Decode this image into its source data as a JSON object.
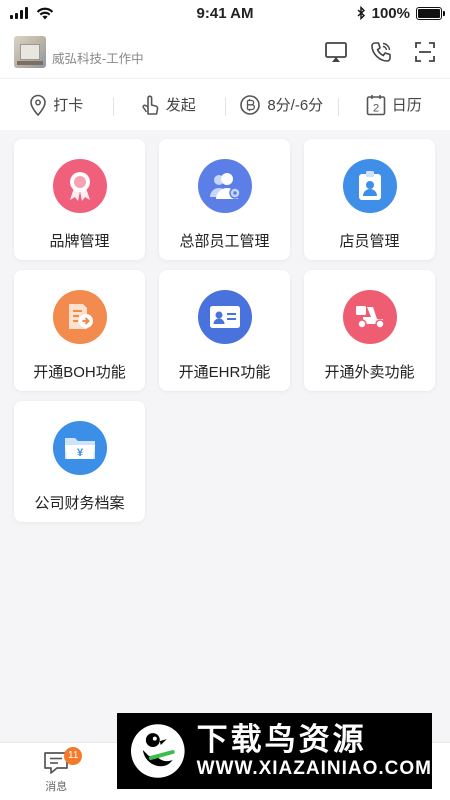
{
  "status_bar": {
    "time": "9:41 AM",
    "battery": "100%"
  },
  "header": {
    "company": "威弘科技-工作中"
  },
  "quick_actions": [
    {
      "label": "打卡",
      "icon": "location-pin-icon"
    },
    {
      "label": "发起",
      "icon": "hand-icon"
    },
    {
      "label": "8分/-6分",
      "icon": "coin-icon"
    },
    {
      "label": "日历",
      "icon": "calendar-icon",
      "day": "2"
    }
  ],
  "modules": [
    {
      "label": "品牌管理",
      "icon": "ribbon-award-icon",
      "color": "#f0607d"
    },
    {
      "label": "总部员工管理",
      "icon": "staff-gear-icon",
      "color": "#5b7fe6"
    },
    {
      "label": "店员管理",
      "icon": "badge-id-icon",
      "color": "#3f8ee8"
    },
    {
      "label": "开通BOH功能",
      "icon": "document-arrow-icon",
      "color": "#f38a4e"
    },
    {
      "label": "开通EHR功能",
      "icon": "id-card-icon",
      "color": "#4a72dc"
    },
    {
      "label": "开通外卖功能",
      "icon": "scooter-icon",
      "color": "#ef5d73"
    },
    {
      "label": "公司财务档案",
      "icon": "finance-folder-icon",
      "color": "#3b8fe6",
      "symbol": "¥"
    }
  ],
  "tabbar": {
    "messages": {
      "label": "消息",
      "badge": "11"
    }
  },
  "watermark": {
    "brand": "下载鸟资源",
    "url": "WWW.XIAZAINIAO.COM"
  },
  "colors": {
    "accent": "#2f6fd6",
    "badge": "#f47a2a"
  }
}
